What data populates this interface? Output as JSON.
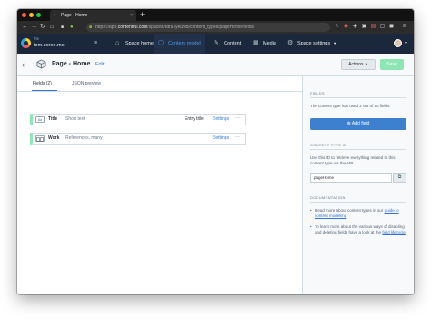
{
  "browser": {
    "tab_title": "Page - Home",
    "new_tab": "+",
    "url_prefix": "https://app.",
    "url_host": "contentful.com",
    "url_path": "/spaces/sdfu7yeizod/content_types/pageHome/fields"
  },
  "appnav": {
    "org_label": "Me",
    "space_name": "tom.sereo.me",
    "items": [
      {
        "label": "Space home",
        "icon": "home-icon"
      },
      {
        "label": "Content model",
        "icon": "content-model-icon"
      },
      {
        "label": "Content",
        "icon": "content-icon"
      },
      {
        "label": "Media",
        "icon": "media-icon"
      },
      {
        "label": "Space settings",
        "icon": "gear-icon"
      }
    ],
    "colors": {
      "nav_bg": "#1b273a",
      "active_bg": "#223149",
      "active_text": "#4f9cea"
    }
  },
  "page": {
    "title": "Page - Home",
    "edit_label": "Edit",
    "actions_label": "Actions",
    "save_label": "Save"
  },
  "tabs": [
    {
      "label": "Fields (2)",
      "active": true
    },
    {
      "label": "JSON preview",
      "active": false
    }
  ],
  "fields": [
    {
      "icon_text": "Aa",
      "name": "Title",
      "type": "Short text",
      "entry_title": "Entry title",
      "settings": "Settings",
      "more": "···"
    },
    {
      "icon_text": "",
      "name": "Work",
      "type": "References, many",
      "entry_title": "",
      "settings": "Settings",
      "more": "···"
    }
  ],
  "sidebar": {
    "fields_heading": "FIELDS",
    "fields_text": "The content type has used 2 out of 50 fields.",
    "add_field_label": "Add field",
    "id_heading": "CONTENT TYPE ID",
    "id_text": "Use this ID to retrieve everything related to this content type via the API.",
    "id_value": "pageHome",
    "docs_heading": "DOCUMENTATION",
    "doc1_text": "Read more about content types in our",
    "doc1_link": "guide to content modelling",
    "doc2_text": "To learn more about the various ways of disabling and deleting fields have a look at the",
    "doc2_link": "field lifecycle"
  },
  "colors": {
    "accent": "#2e75d4",
    "add_button": "#3c80cf",
    "save_button": "#8fe6b5",
    "field_accent": "#8fe6b5"
  }
}
